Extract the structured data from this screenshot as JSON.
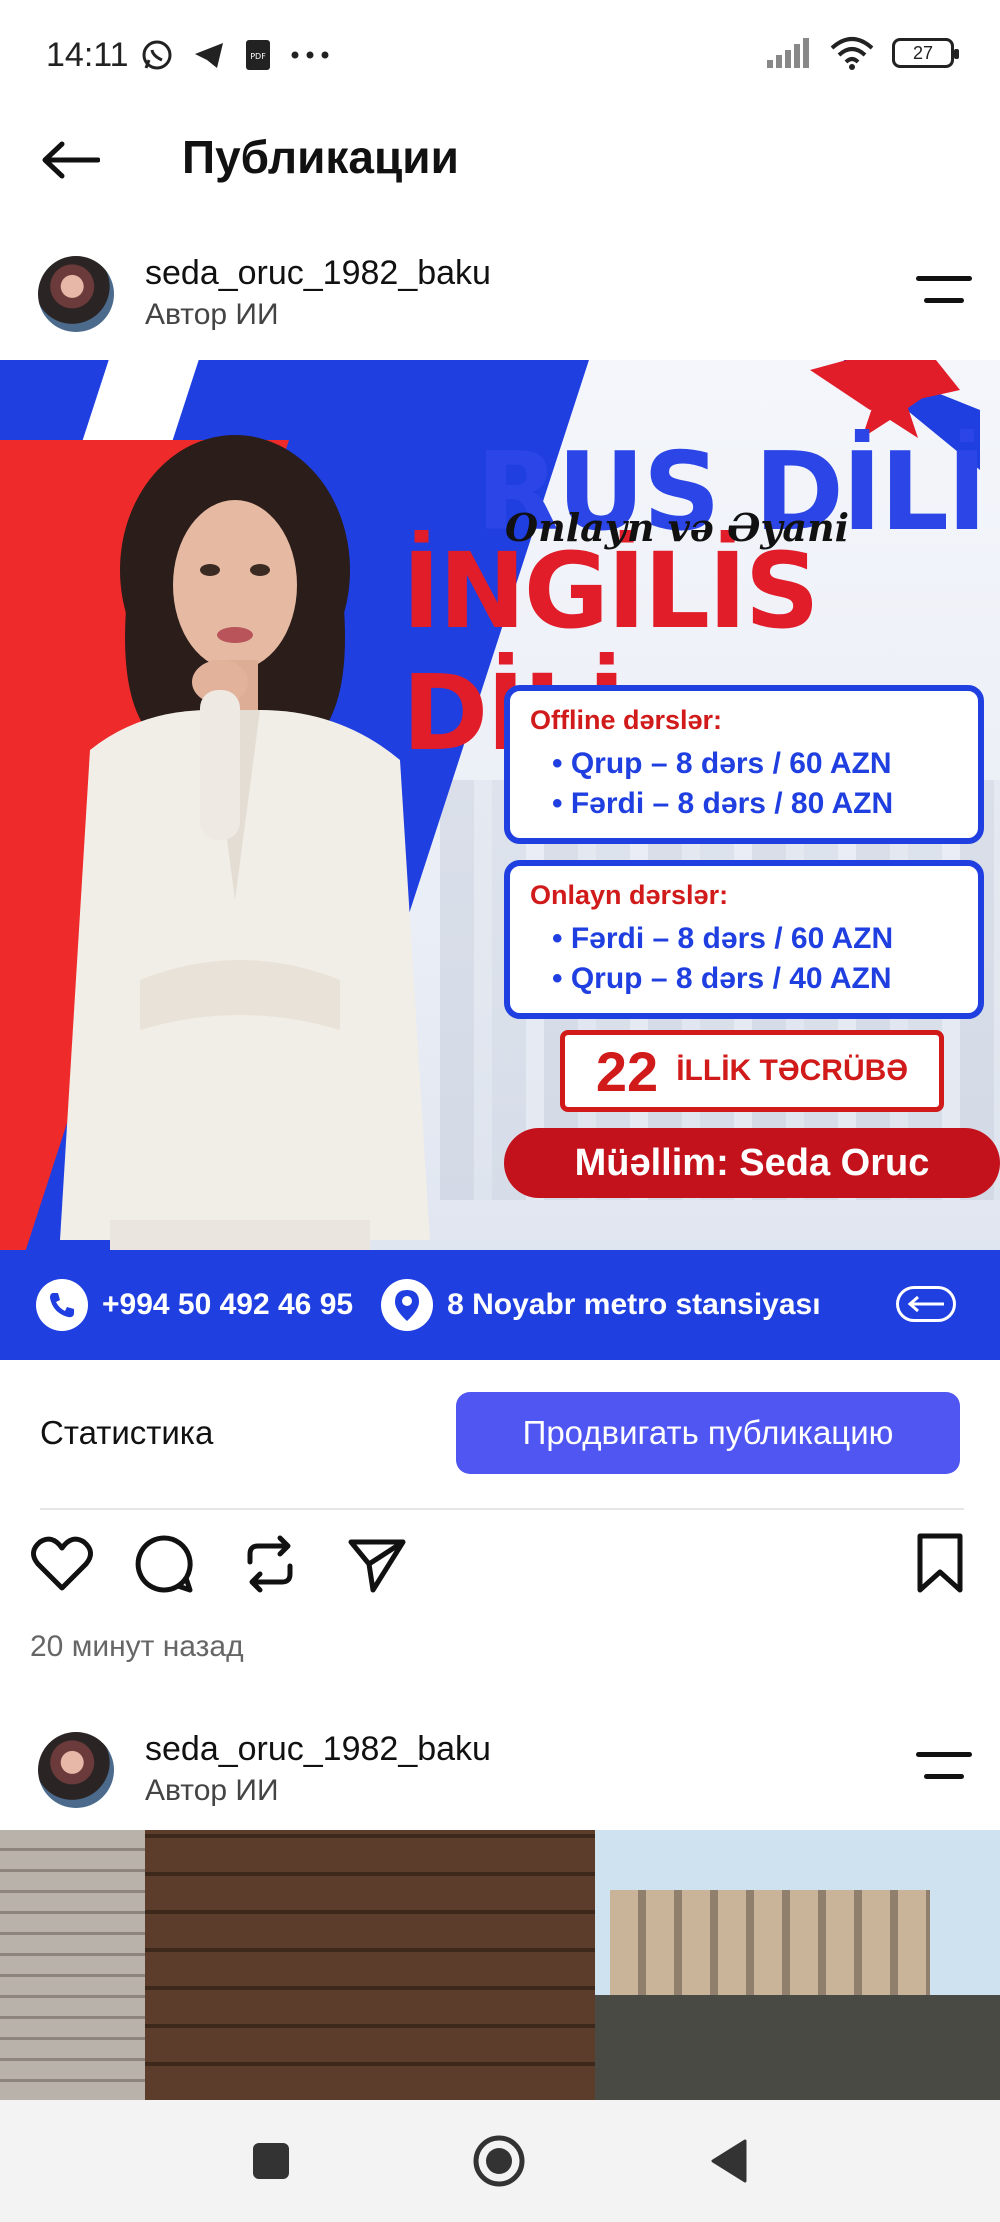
{
  "status_bar": {
    "time": "14:11",
    "battery": "27",
    "notification_icons": [
      "whatsapp-icon",
      "telegram-icon",
      "pdf-icon",
      "more-dots-icon"
    ]
  },
  "header": {
    "title": "Публикации"
  },
  "posts": [
    {
      "username": "seda_oruc_1982_baku",
      "subtitle": "Автор ИИ",
      "ad": {
        "title_1": "RUS DİLİ",
        "script_text": "Onlayn və Əyani",
        "title_2": "İNGİLİS DİLİ",
        "offline": {
          "heading": "Offline dərslər:",
          "lines": [
            "• Qrup – 8 dərs / 60 AZN",
            "• Fərdi – 8 dərs / 80 AZN"
          ]
        },
        "online": {
          "heading": "Onlayn dərslər:",
          "lines": [
            "• Fərdi – 8 dərs / 60 AZN",
            "• Qrup – 8 dərs / 40 AZN"
          ]
        },
        "experience_number": "22",
        "experience_text": "İLLİK TƏCRÜBƏ",
        "teacher": "Müəllim: Seda Oruc",
        "phone": "+994 50 492 46 95",
        "location": "8 Noyabr metro stansiyası"
      },
      "stats_label": "Статистика",
      "promote_label": "Продвигать публикацию",
      "time_ago": "20 минут назад"
    },
    {
      "username": "seda_oruc_1982_baku",
      "subtitle": "Автор ИИ"
    }
  ],
  "colors": {
    "brand_blue": "#1f3fe0",
    "brand_red": "#e11d2a",
    "promote_button": "#5056f2"
  }
}
